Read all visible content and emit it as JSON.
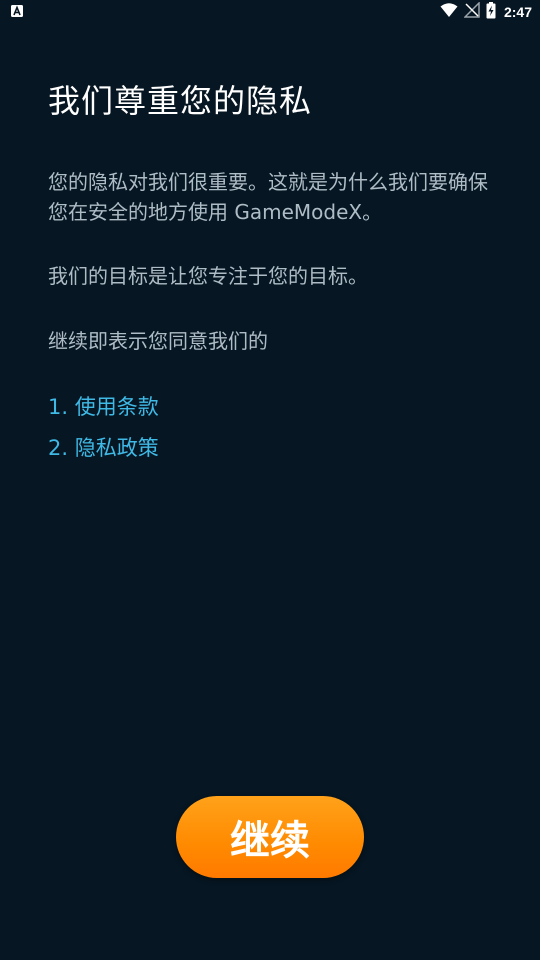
{
  "status_bar": {
    "time": "2:47",
    "icons": [
      "notification-a-icon",
      "wifi-icon",
      "no-signal-icon",
      "battery-charging-icon"
    ]
  },
  "content": {
    "title": "我们尊重您的隐私",
    "paragraph1": "您的隐私对我们很重要。这就是为什么我们要确保您在安全的地方使用 GameModeX。",
    "paragraph2": "我们的目标是让您专注于您的目标。",
    "paragraph3": "继续即表示您同意我们的",
    "links": [
      {
        "label": "1. 使用条款"
      },
      {
        "label": "2. 隐私政策"
      }
    ]
  },
  "actions": {
    "continue_label": "继续"
  },
  "colors": {
    "background": "#061622",
    "link": "#3fb9e6",
    "button": "#ff8a00"
  }
}
